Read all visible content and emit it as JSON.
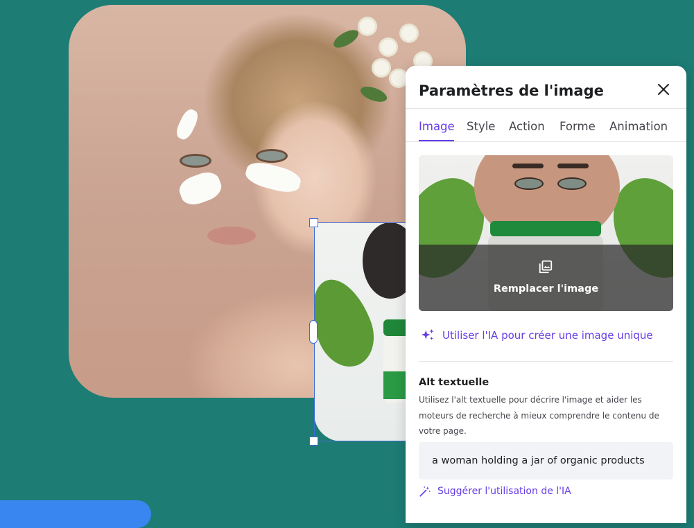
{
  "canvas": {
    "background_color": "#1d7c74",
    "main_photo_alt": "woman with cream on face",
    "second_photo_alt": "woman holding green jar"
  },
  "panel": {
    "title": "Paramètres de l'image",
    "close_icon": "close-icon",
    "tabs": [
      {
        "label": "Image",
        "active": true
      },
      {
        "label": "Style",
        "active": false
      },
      {
        "label": "Action",
        "active": false
      },
      {
        "label": "Forme",
        "active": false
      },
      {
        "label": "Animation",
        "active": false
      }
    ],
    "preview": {
      "replace_label": "Remplacer l'image",
      "replace_icon": "gallery-icon"
    },
    "ai_link": {
      "label": "Utiliser l'IA pour créer une image unique",
      "icon": "sparkle-icon"
    },
    "alt_text": {
      "title": "Alt textuelle",
      "description": "Utilisez l'alt textuelle pour décrire l'image et aider les moteurs de recherche à mieux comprendre le contenu de votre page.",
      "value": "a woman holding a jar of organic products"
    },
    "suggest_link": {
      "label": "Suggérer l'utilisation de l'IA",
      "icon": "magic-wand-icon"
    },
    "accent_color": "#673de6"
  }
}
